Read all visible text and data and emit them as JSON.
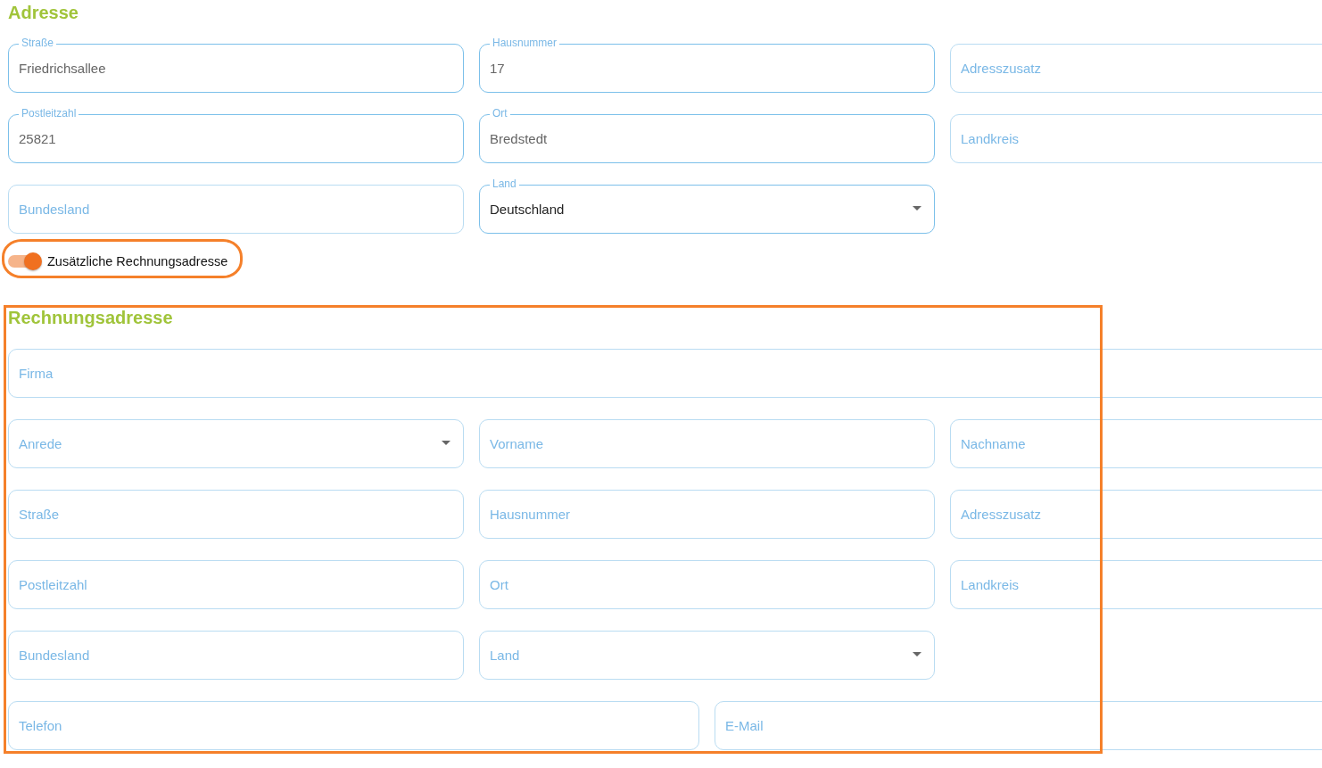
{
  "address": {
    "title": "Adresse",
    "rows": [
      [
        {
          "kind": "text",
          "label": "Straße",
          "value": "Friedrichsallee"
        },
        {
          "kind": "text",
          "label": "Hausnummer",
          "value": "17"
        },
        {
          "kind": "text",
          "placeholder": "Adresszusatz"
        }
      ],
      [
        {
          "kind": "text",
          "label": "Postleitzahl",
          "value": "25821"
        },
        {
          "kind": "text",
          "label": "Ort",
          "value": "Bredstedt"
        },
        {
          "kind": "text",
          "placeholder": "Landkreis"
        }
      ],
      [
        {
          "kind": "text",
          "placeholder": "Bundesland"
        },
        {
          "kind": "select",
          "label": "Land",
          "value": "Deutschland"
        }
      ]
    ]
  },
  "billing_toggle": {
    "label": "Zusätzliche Rechnungsadresse",
    "on": true,
    "highlighted": true
  },
  "billing": {
    "title": "Rechnungsadresse",
    "highlighted": true,
    "rows": [
      [
        {
          "kind": "text",
          "placeholder": "Firma"
        }
      ],
      [
        {
          "kind": "select",
          "placeholder": "Anrede"
        },
        {
          "kind": "text",
          "placeholder": "Vorname"
        },
        {
          "kind": "text",
          "placeholder": "Nachname"
        }
      ],
      [
        {
          "kind": "text",
          "placeholder": "Straße"
        },
        {
          "kind": "text",
          "placeholder": "Hausnummer"
        },
        {
          "kind": "text",
          "placeholder": "Adresszusatz"
        }
      ],
      [
        {
          "kind": "text",
          "placeholder": "Postleitzahl"
        },
        {
          "kind": "text",
          "placeholder": "Ort"
        },
        {
          "kind": "text",
          "placeholder": "Landkreis"
        }
      ],
      [
        {
          "kind": "text",
          "placeholder": "Bundesland"
        },
        {
          "kind": "select",
          "placeholder": "Land"
        }
      ],
      [
        {
          "kind": "tel",
          "placeholder": "Telefon"
        },
        {
          "kind": "email",
          "placeholder": "E-Mail"
        }
      ]
    ]
  }
}
